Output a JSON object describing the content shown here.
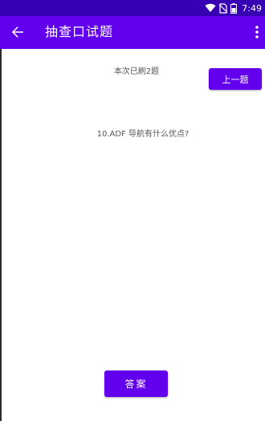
{
  "status_bar": {
    "time": "7:49",
    "background_color": "#3700B3",
    "icons": [
      "wifi-icon",
      "no-sim-icon",
      "battery-icon"
    ]
  },
  "app_bar": {
    "title": "抽查口试题",
    "background_color": "#6200EE",
    "back_icon": "arrow-left-icon",
    "overflow_icon": "more-vert-icon"
  },
  "main": {
    "counter_text": "本次已刷2题",
    "prev_button_label": "上一题",
    "question_text": "10.ADF 导航有什么优点?",
    "answer_button_label": "答案"
  },
  "colors": {
    "accent": "#6200EE",
    "status_bar": "#3700B3",
    "text_secondary": "#555555"
  }
}
